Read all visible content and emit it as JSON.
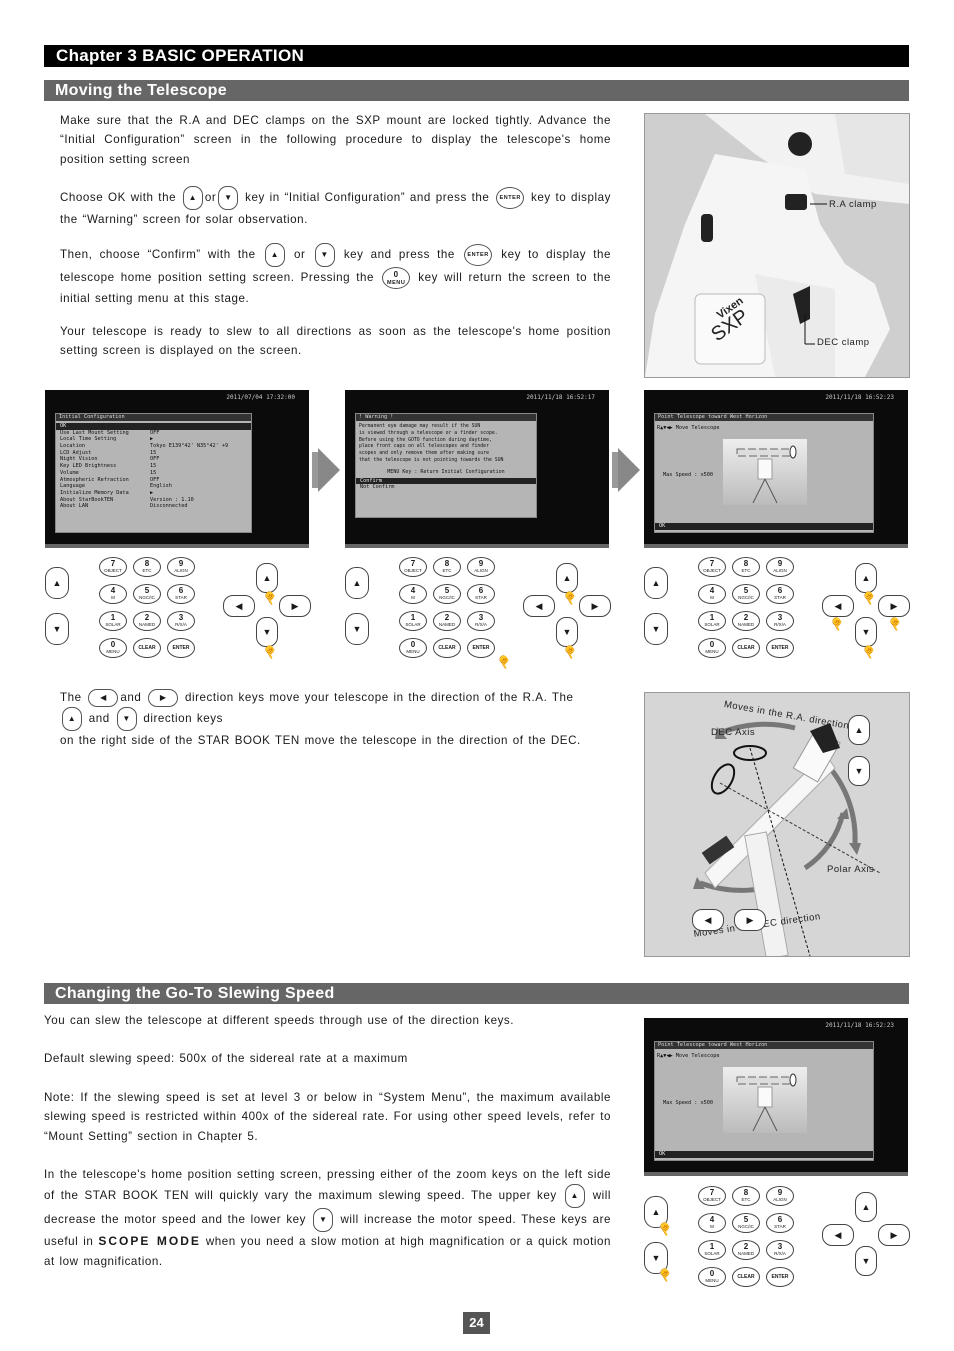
{
  "chapter": {
    "title": "Chapter 3  BASIC OPERATION"
  },
  "section1": {
    "title": "Moving the Telescope",
    "para1": "Make sure that the R.A and DEC clamps on the SXP mount are locked tightly.  Advance the “Initial Configuration” screen in the following procedure to display the telescope's home position setting screen",
    "para2": {
      "a": "Choose OK with the",
      "b": "or",
      "c": "key in “Initial Configuration” and press the",
      "d": "key to display the “Warning” screen for solar observation."
    },
    "para3": {
      "a": "Then, choose “Confirm” with the",
      "b": "or",
      "c": "key and press the",
      "d": "key to display the telescope home position setting screen.  Pressing the",
      "e": "key will return the screen to the initial setting menu at this stage."
    },
    "para4": "Your telescope is ready to slew to all directions as soon as the telescope's home position setting screen is displayed on the screen.",
    "photo_labels": {
      "ra_clamp": "R.A clamp",
      "dec_clamp": "DEC clamp",
      "brand": "Vixen",
      "model": "SXP"
    },
    "direction_para": {
      "a": "The",
      "b": "and",
      "c": "direction keys move your telescope in the direction of the R.A.  The",
      "d": "and",
      "e": "direction keys",
      "f": "on the right side of the STAR BOOK TEN move the telescope in the direction of the DEC."
    },
    "diagram_labels": {
      "ra_dir": "Moves in the R.A. direction",
      "dec_axis": "DEC Axis",
      "polar_axis": "Polar Axis",
      "dec_dir": "Moves in the DEC direction"
    }
  },
  "screens": {
    "initial": {
      "timestamp": "2011/07/04 17:32:00",
      "title": "Initial Configuration",
      "selected": "OK",
      "rows": [
        {
          "k": "Use Last Mount Setting",
          "v": "OFF"
        },
        {
          "k": "Local Time Setting",
          "v": "▶"
        },
        {
          "k": "Location",
          "v": "Tokyo E139°42' N35°42' +9"
        },
        {
          "k": "LCD Adjust",
          "v": "15"
        },
        {
          "k": "Night Vision",
          "v": "OFF"
        },
        {
          "k": "Key LED Brightness",
          "v": "15"
        },
        {
          "k": "Volume",
          "v": "15"
        },
        {
          "k": "Atmospheric Refraction",
          "v": "OFF"
        },
        {
          "k": "Language",
          "v": "English"
        },
        {
          "k": "Initialize Memory Data",
          "v": "▶"
        },
        {
          "k": "About StarBookTEN",
          "v": "Version : 1.10"
        },
        {
          "k": "About LAN",
          "v": "Disconnected"
        }
      ]
    },
    "warning": {
      "timestamp": "2011/11/18 16:52:17",
      "title": "! Warning !",
      "lines": [
        "Permanent eye damage may result if the SUN",
        "is viewed through a telescope or a finder scope.",
        "Before using the GOTO function during daytime,",
        "place front caps on all telescopes and finder",
        "scopes and only remove them after making sure",
        "that the telescope is not pointing towards the SUN"
      ],
      "menu_hint": "MENU Key : Return Initial Configuration",
      "options": [
        "Confirm",
        "Not Confirm"
      ]
    },
    "point": {
      "timestamp": "2011/11/18 16:52:23",
      "title": "Point Telescope toward West Horizon",
      "hint": "R▲▼◀▶ Move Telescope",
      "speed": "Max Speed : x500",
      "ok": "OK"
    }
  },
  "keypad": {
    "numkeys": [
      {
        "n": "7",
        "s": "OBJECT"
      },
      {
        "n": "8",
        "s": "ETC"
      },
      {
        "n": "9",
        "s": "ALIGN"
      },
      {
        "n": "4",
        "s": "M"
      },
      {
        "n": "5",
        "s": "NGC/IC"
      },
      {
        "n": "6",
        "s": "STAR"
      },
      {
        "n": "1",
        "s": "SOLAR"
      },
      {
        "n": "2",
        "s": "NAMED"
      },
      {
        "n": "3",
        "s": "R/X/A"
      },
      {
        "n": "0",
        "s": "MENU"
      },
      {
        "n": "CLEAR",
        "s": ""
      },
      {
        "n": "ENTER",
        "s": ""
      }
    ],
    "up": "▲",
    "down": "▼",
    "left": "◀",
    "right": "▶",
    "enter_label": "ENTER",
    "menu_num": "0",
    "menu_label": "MENU"
  },
  "section2": {
    "title": "Changing the Go-To Slewing Speed",
    "para1": "You can slew the telescope at different speeds through use of the direction keys.",
    "para2": "Default slewing speed: 500x of the sidereal rate at a maximum",
    "para3": "Note: If the slewing speed is set at level 3 or below in “System Menu”, the maximum available slewing speed is restricted within 400x of the sidereal rate.  For using other speed levels, refer to “Mount Setting” section in Chapter 5.",
    "para4": {
      "a": "In the telescope's home position setting screen, pressing either of the zoom keys on the left side of the STAR BOOK TEN will quickly vary the maximum slewing speed.  The upper key",
      "b": "will decrease the motor speed and the lower key",
      "c": "will increase the motor speed. These keys are useful in",
      "mode": "SCOPE MODE",
      "d": "when you need a slow motion at high magnification or a quick motion at low magnification."
    }
  },
  "page_number": "24"
}
